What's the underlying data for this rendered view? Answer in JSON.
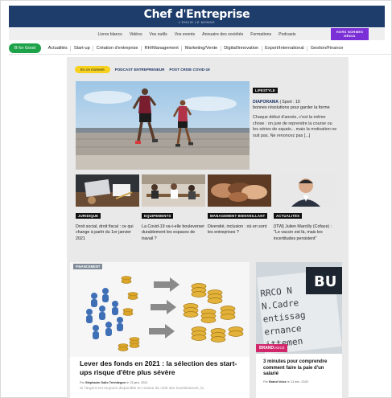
{
  "header": {
    "logo_main": "Chef d",
    "logo_accent": "'",
    "logo_end": "Entreprise",
    "logo_sub": "L'ENVIE LE MONDE"
  },
  "util_nav": {
    "items": [
      "Livres blancs",
      "Vidéos",
      "Vos outils",
      "Vos events",
      "Annuaire des sociétés",
      "Formations",
      "Podcasts"
    ],
    "special": "HORS NORMES\nMÉDIA"
  },
  "main_nav": {
    "bforgood": "B for Good",
    "items": [
      "Actualités",
      "Start-up",
      "Création d'entreprise",
      "RH/Management",
      "Marketing/Vente",
      "Digital/Innovation",
      "Export/International",
      "Gestion/Finance"
    ]
  },
  "pills": {
    "moment": "En ce moment",
    "links": [
      "PODCAST ENTREPRENEUR",
      "POST CRISE COVID-19"
    ]
  },
  "hero": {
    "tag": "LIFESTYLE",
    "kicker": "DIAPORAMA",
    "kicker_rest": " | Sport : 10",
    "title": "bonnes résolutions pour garder la forme",
    "desc": "Chaque début d'année, c'est la même chose : on jure de reprendre la course ou les séries de squats... mais la motivation ne suit pas. Ne renoncez pas [...]"
  },
  "cards": [
    {
      "tag": "JURIDIQUE",
      "title": "Droit social, droit fiscal : ce qui change à partir du 1er janvier 2021"
    },
    {
      "tag": "EQUIPEMENTS",
      "title": "La Covid-19 va-t-elle bouleverser durablement les espaces de travail ?"
    },
    {
      "tag": "MANAGEMENT BIENVEILLANT",
      "title": "Diversité, inclusion : où en sont les entreprises ?"
    },
    {
      "tag": "ACTUALITÉS",
      "title": "[ITW] Julien Marcilly (Coface) : \"Le vaccin est là, mais les incertitudes persistent\""
    }
  ],
  "bottom_main": {
    "tag": "FINANCEMENT",
    "title": "Lever des fonds en 2021 : la sélection des start-ups risque d'être plus sévère",
    "meta_by": "Par ",
    "meta_author": "Stéphanie Gallo Trévidegon",
    "meta_date": " le 13 janv. 2021",
    "excerpt": "Si l'argent est toujours disponible en masse du côté des investisseurs, la"
  },
  "bottom_side": {
    "tag_main": "BRAND",
    "tag_sub": "VOICE",
    "title": "3 minutes pour comprendre comment faire la paie d'un salarié",
    "meta_by": "Par ",
    "meta_author": "Brand Voice",
    "meta_date": " le 13 déc. 2020"
  },
  "colors": {
    "header_bg": "#1f3d6b",
    "bforgood": "#1ea24a",
    "pill": "#f6d11d",
    "hors_normes": "#7b2fd6",
    "brand_voice": "#d1286c"
  }
}
